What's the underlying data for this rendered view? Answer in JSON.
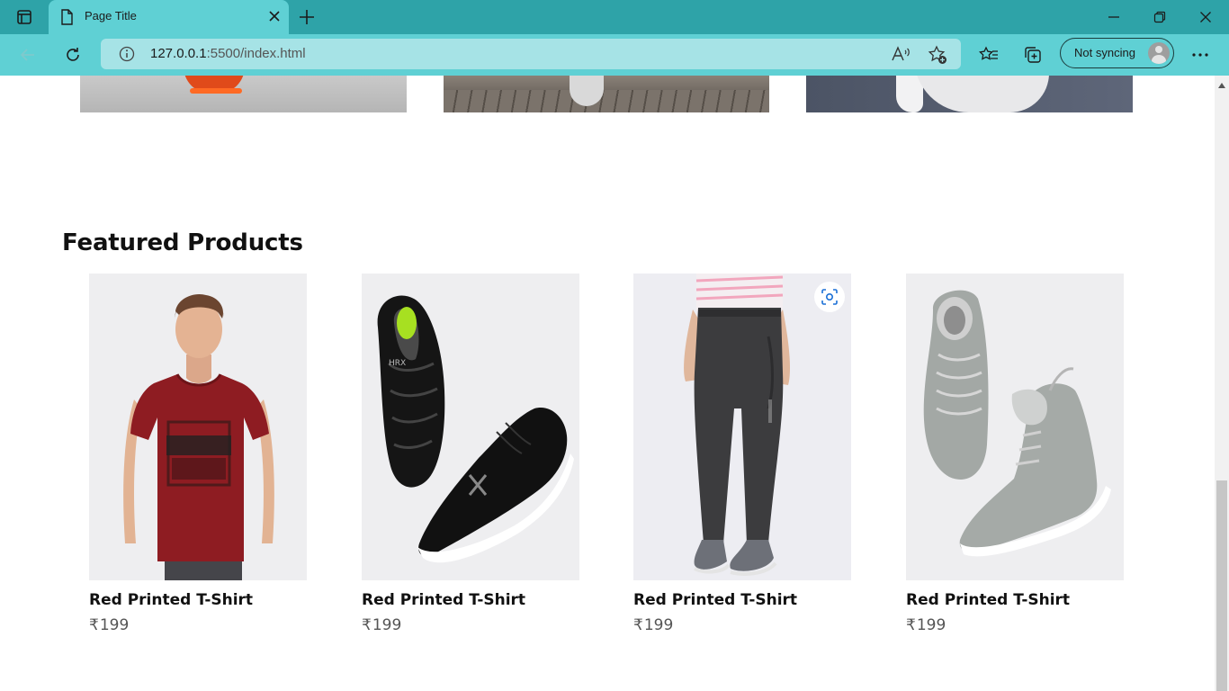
{
  "browser": {
    "tab_title": "Page Title",
    "url_host": "127.0.0.1",
    "url_path": ":5500/index.html",
    "sync_label": "Not syncing",
    "accent": "#2ea3a8",
    "toolbar_color": "#5fd0d4"
  },
  "page": {
    "section_title": "Featured Products",
    "currency_symbol": "₹",
    "products": [
      {
        "name": "Red Printed T-Shirt",
        "price": "199",
        "image": "red-tshirt-model"
      },
      {
        "name": "Red Printed T-Shirt",
        "price": "199",
        "image": "black-sneakers"
      },
      {
        "name": "Red Printed T-Shirt",
        "price": "199",
        "image": "grey-joggers"
      },
      {
        "name": "Red Printed T-Shirt",
        "price": "199",
        "image": "grey-high-top-shoes"
      }
    ]
  }
}
